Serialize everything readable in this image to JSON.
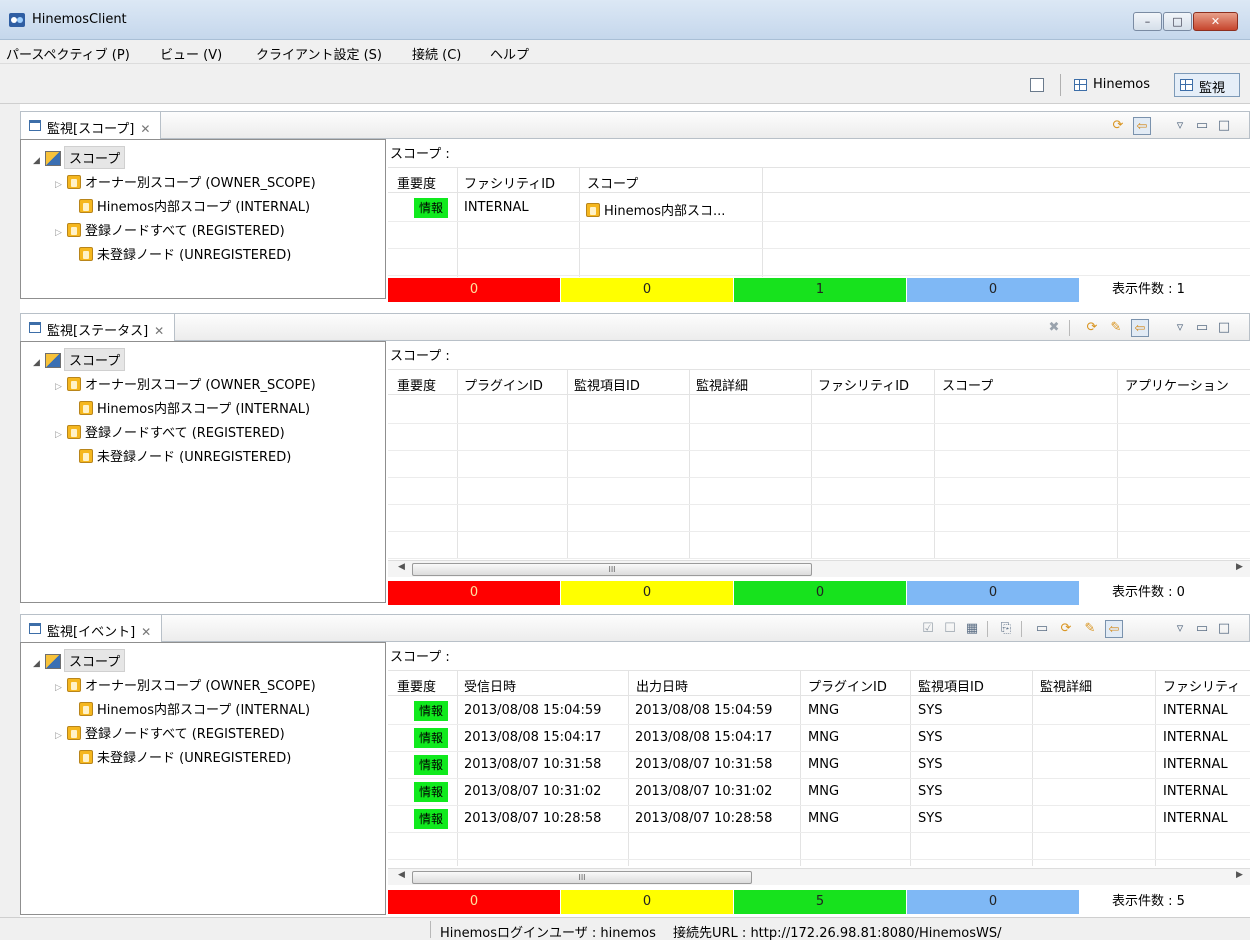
{
  "window": {
    "title": "HinemosClient",
    "minimize": "–",
    "maximize": "□",
    "close": "✕"
  },
  "menu": [
    "パースペクティブ (P)",
    "ビュー (V)",
    "クライアント設定 (S)",
    "接続 (C)",
    "ヘルプ"
  ],
  "perspectives": {
    "hinemos": "Hinemos",
    "monitor": "監視"
  },
  "severity_counts_colors": {
    "critical": "#ff0000",
    "warning": "#ffff00",
    "info": "#17e21d",
    "unknown": "#7fb8f5"
  },
  "tree": {
    "root": "スコープ",
    "children": [
      "オーナー別スコープ (OWNER_SCOPE)",
      "Hinemos内部スコープ (INTERNAL)",
      "登録ノードすべて (REGISTERED)",
      "未登録ノード (UNREGISTERED)"
    ]
  },
  "scope_view": {
    "tab": "監視[スコープ]",
    "scope_label": "スコープ :",
    "columns": [
      "重要度",
      "ファシリティID",
      "スコープ"
    ],
    "rows": [
      {
        "severity": "情報",
        "facility_id": "INTERNAL",
        "scope": "Hinemos内部スコ..."
      }
    ],
    "counts": [
      "0",
      "0",
      "1",
      "0"
    ],
    "total": "表示件数 : 1"
  },
  "status_view": {
    "tab": "監視[ステータス]",
    "scope_label": "スコープ :",
    "columns": [
      "重要度",
      "プラグインID",
      "監視項目ID",
      "監視詳細",
      "ファシリティID",
      "スコープ",
      "アプリケーション"
    ],
    "counts": [
      "0",
      "0",
      "0",
      "0"
    ],
    "total": "表示件数 : 0",
    "scroll_thumb": "III"
  },
  "event_view": {
    "tab": "監視[イベント]",
    "scope_label": "スコープ :",
    "columns": [
      "重要度",
      "受信日時",
      "出力日時",
      "プラグインID",
      "監視項目ID",
      "監視詳細",
      "ファシリティ"
    ],
    "rows": [
      {
        "severity": "情報",
        "received": "2013/08/08 15:04:59",
        "output": "2013/08/08 15:04:59",
        "plugin": "MNG",
        "monitor": "SYS",
        "detail": "",
        "facility": "INTERNAL"
      },
      {
        "severity": "情報",
        "received": "2013/08/08 15:04:17",
        "output": "2013/08/08 15:04:17",
        "plugin": "MNG",
        "monitor": "SYS",
        "detail": "",
        "facility": "INTERNAL"
      },
      {
        "severity": "情報",
        "received": "2013/08/07 10:31:58",
        "output": "2013/08/07 10:31:58",
        "plugin": "MNG",
        "monitor": "SYS",
        "detail": "",
        "facility": "INTERNAL"
      },
      {
        "severity": "情報",
        "received": "2013/08/07 10:31:02",
        "output": "2013/08/07 10:31:02",
        "plugin": "MNG",
        "monitor": "SYS",
        "detail": "",
        "facility": "INTERNAL"
      },
      {
        "severity": "情報",
        "received": "2013/08/07 10:28:58",
        "output": "2013/08/07 10:28:58",
        "plugin": "MNG",
        "monitor": "SYS",
        "detail": "",
        "facility": "INTERNAL"
      }
    ],
    "counts": [
      "0",
      "0",
      "5",
      "0"
    ],
    "total": "表示件数 : 5",
    "scroll_thumb": "III"
  },
  "statusbar": "Hinemosログインユーザ : hinemos　 接続先URL : http://172.26.98.81:8080/HinemosWS/"
}
